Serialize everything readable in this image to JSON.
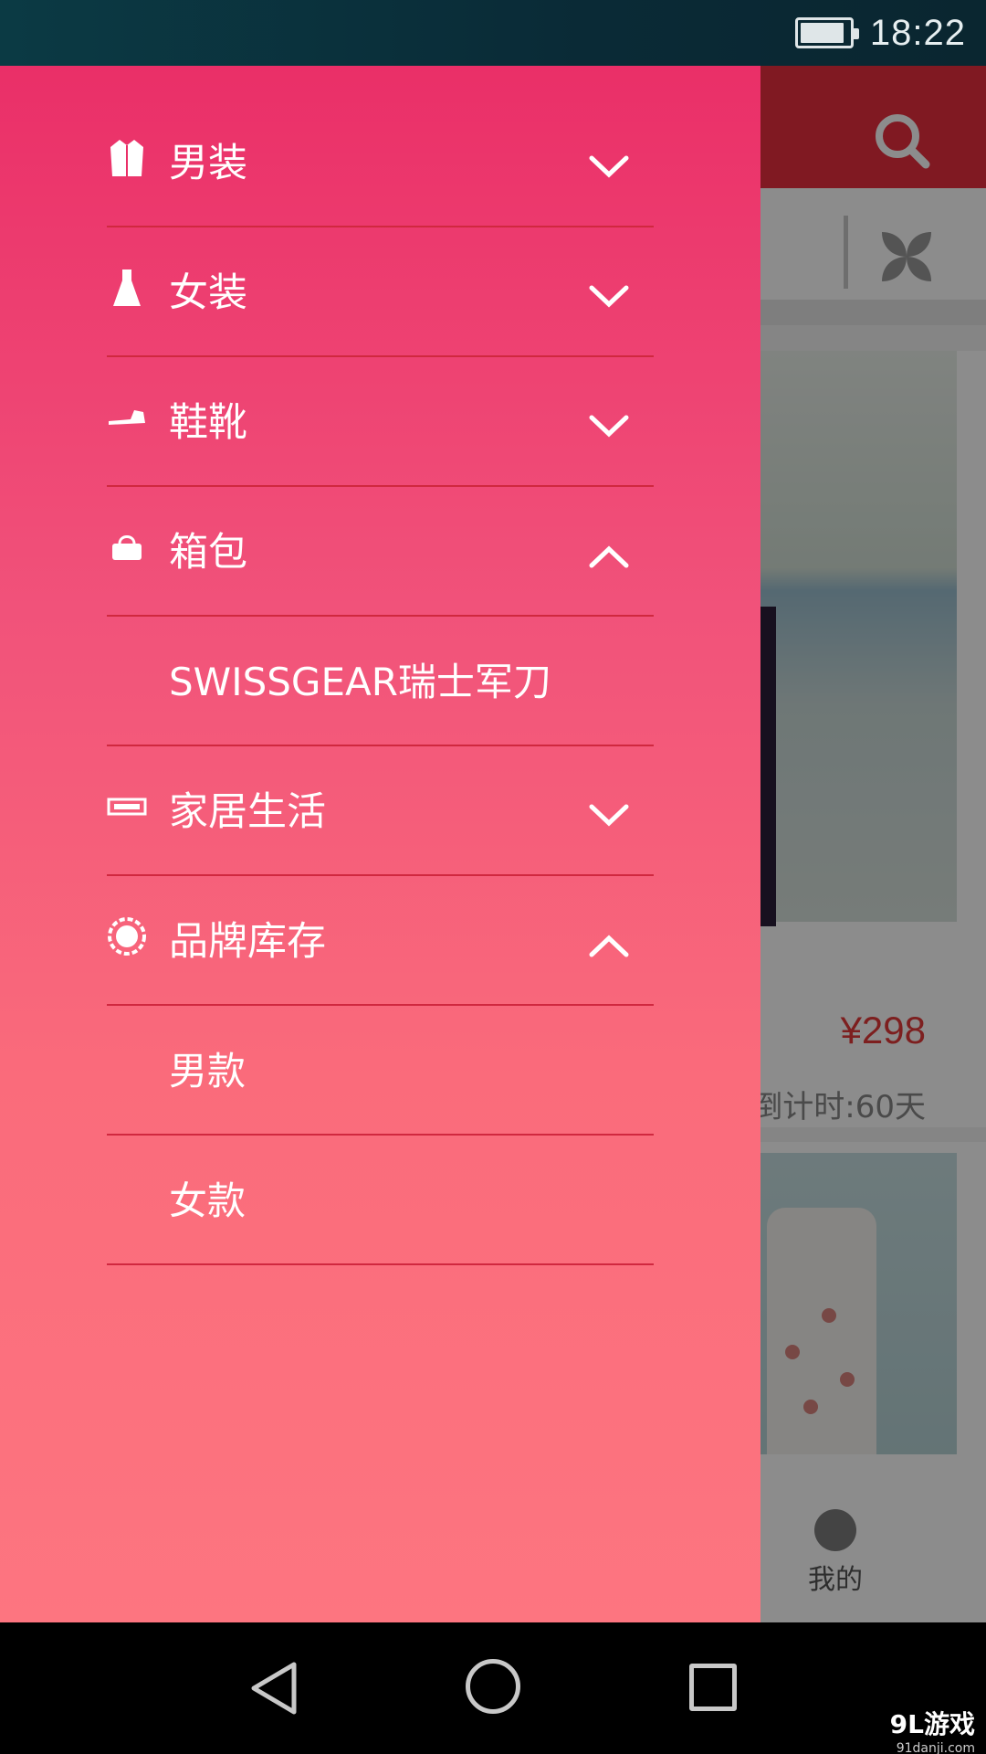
{
  "status_bar": {
    "time": "18:22",
    "battery_level": 0.9
  },
  "background_app": {
    "price": "¥298",
    "countdown": "倒计时:60天",
    "tab_me_label": "我的",
    "colors": {
      "header": "#ea2f3e",
      "price": "#e33a3a"
    }
  },
  "drawer": {
    "colors": {
      "top": "#ea2f68",
      "bottom": "#fd7580",
      "divider": "#d0283f"
    },
    "items": [
      {
        "label": "男装",
        "icon": "coat-icon",
        "state": "collapsed"
      },
      {
        "label": "女装",
        "icon": "dress-icon",
        "state": "collapsed"
      },
      {
        "label": "鞋靴",
        "icon": "shoe-icon",
        "state": "collapsed"
      },
      {
        "label": "箱包",
        "icon": "bag-icon",
        "state": "expanded"
      },
      {
        "label": "SWISSGEAR瑞士军刀",
        "sub": true
      },
      {
        "label": "家居生活",
        "icon": "home-goods-icon",
        "state": "collapsed"
      },
      {
        "label": "品牌库存",
        "icon": "sale-badge-icon",
        "state": "expanded"
      },
      {
        "label": "男款",
        "sub": true
      },
      {
        "label": "女款",
        "sub": true
      }
    ]
  },
  "watermark": {
    "main": "9L游戏",
    "sub": "91danji.com"
  }
}
